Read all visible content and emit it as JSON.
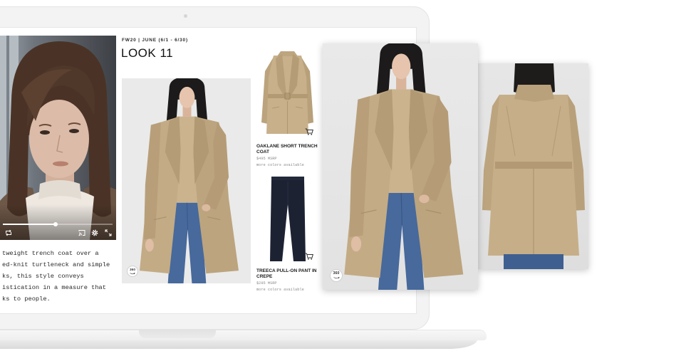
{
  "colors": {
    "page_bg": "#ffffff",
    "laptop_body": "#f3f3f3",
    "text_primary": "#222222",
    "text_muted": "#8c8c8c",
    "coat_beige": "#c3ab85",
    "denim_blue": "#47699c",
    "pant_navy": "#1d2233"
  },
  "video": {
    "progress": 0.48,
    "controls_left": [
      "loop-icon"
    ],
    "controls_right": [
      "cast-icon",
      "gear-icon",
      "fullscreen-icon"
    ]
  },
  "lookbook": {
    "season_line": "FW20 | JUNE (6/1 - 6/30)",
    "look_title": "LOOK 11",
    "description_lines": [
      "tweight trench coat over a",
      "ed-knit turtleneck and simple",
      "ks, this style conveys",
      "istication in a measure that",
      "ks to people."
    ],
    "main_image": {
      "badge": "360"
    },
    "products": [
      {
        "name": "OAKLANE SHORT TRENCH COAT",
        "price": "$495 MSRP",
        "note": "more colors available",
        "icon": "cart-icon"
      },
      {
        "name": "TREECA PULL-ON PANT IN CREPE",
        "price": "$295 MSRP",
        "note": "more colors available",
        "icon": "cart-icon"
      }
    ]
  },
  "detail_cards": [
    {
      "badge": "360"
    },
    {}
  ]
}
